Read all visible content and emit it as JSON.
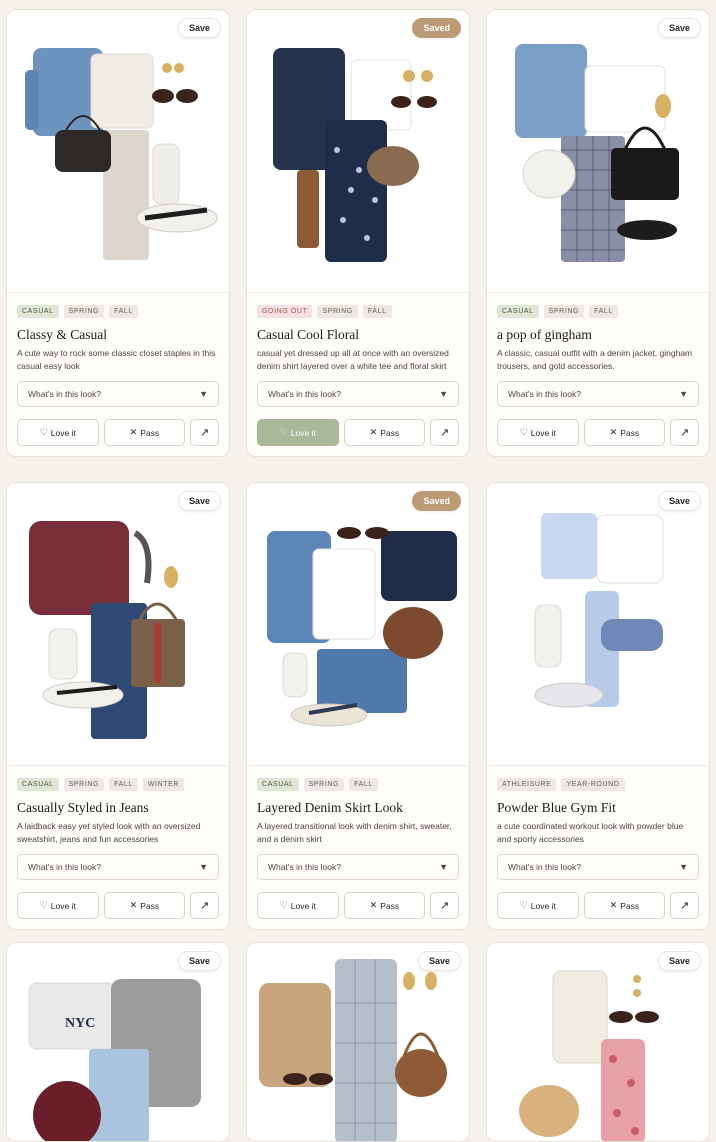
{
  "cards": [
    {
      "save": "Save",
      "saved": false,
      "tags": [
        "CASUAL",
        "SPRING",
        "FALL"
      ],
      "title": "Classy & Casual",
      "desc": "A cute way to rock some classic closet staples in this casual easy look",
      "select": "What's in this look?",
      "love": "Love it",
      "pass": "Pass",
      "loved": false
    },
    {
      "save": "Saved",
      "saved": true,
      "tags": [
        "GOING OUT",
        "SPRING",
        "FALL"
      ],
      "title": "Casual Cool Floral",
      "desc": "casual yet dressed up all at once with an oversized denim shirt layered over a white tee and floral skirt",
      "select": "What's in this look?",
      "love": "Love it",
      "pass": "Pass",
      "loved": true
    },
    {
      "save": "Save",
      "saved": false,
      "tags": [
        "CASUAL",
        "SPRING",
        "FALL"
      ],
      "title": "a pop of gingham",
      "desc": "A classic, casual outfit with a denim jacket, gingham trousers, and gold accessories.",
      "select": "What's in this look?",
      "love": "Love it",
      "pass": "Pass",
      "loved": false
    },
    {
      "save": "Save",
      "saved": false,
      "tags": [
        "CASUAL",
        "SPRING",
        "FALL",
        "WINTER"
      ],
      "title": "Casually Styled in Jeans",
      "desc": "A laidback easy yet styled look with an oversized sweatshirt, jeans and fun accessories",
      "select": "What's in this look?",
      "love": "Love it",
      "pass": "Pass",
      "loved": false
    },
    {
      "save": "Saved",
      "saved": true,
      "tags": [
        "CASUAL",
        "SPRING",
        "FALL"
      ],
      "title": "Layered Denim Skirt Look",
      "desc": "A layered transitional look with denim shirt, sweater, and a denim skirt",
      "select": "What's in this look?",
      "love": "Love it",
      "pass": "Pass",
      "loved": false
    },
    {
      "save": "Save",
      "saved": false,
      "tags": [
        "ATHLEISURE",
        "YEAR-ROUND"
      ],
      "title": "Powder Blue Gym Fit",
      "desc": "a cute coordinated workout look with powder blue and sporty accessories",
      "select": "What's in this look?",
      "love": "Love it",
      "pass": "Pass",
      "loved": false
    },
    {
      "save": "Save",
      "saved": false,
      "print": "NYC"
    },
    {
      "save": "Save",
      "saved": false
    },
    {
      "save": "Save",
      "saved": false
    }
  ],
  "colors": {
    "saved_badge": "#bc9a75",
    "loved_button": "#a8b898",
    "tag_casual": "#dfe6d6",
    "tag_going_out": "#f6e1e0"
  },
  "icons": {
    "love": "heart-icon",
    "pass": "x-icon",
    "share": "arrow-up-right-icon",
    "dropdown": "chevron-down-icon"
  }
}
